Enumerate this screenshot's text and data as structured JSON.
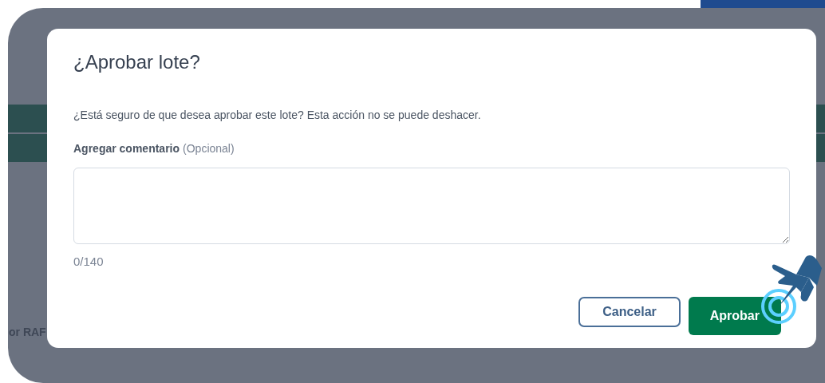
{
  "background": {
    "partial_text": "or RAF"
  },
  "dialog": {
    "title": "¿Aprobar lote?",
    "message": "¿Está seguro de que desea aprobar este lote? Esta acción no se puede deshacer.",
    "comment_label": "Agregar comentario",
    "comment_hint": "(Opcional)",
    "counter": "0/140",
    "buttons": [
      {
        "label": "Cancelar",
        "kind": "secondary"
      },
      {
        "label": "Aprobar",
        "kind": "primary"
      }
    ]
  }
}
